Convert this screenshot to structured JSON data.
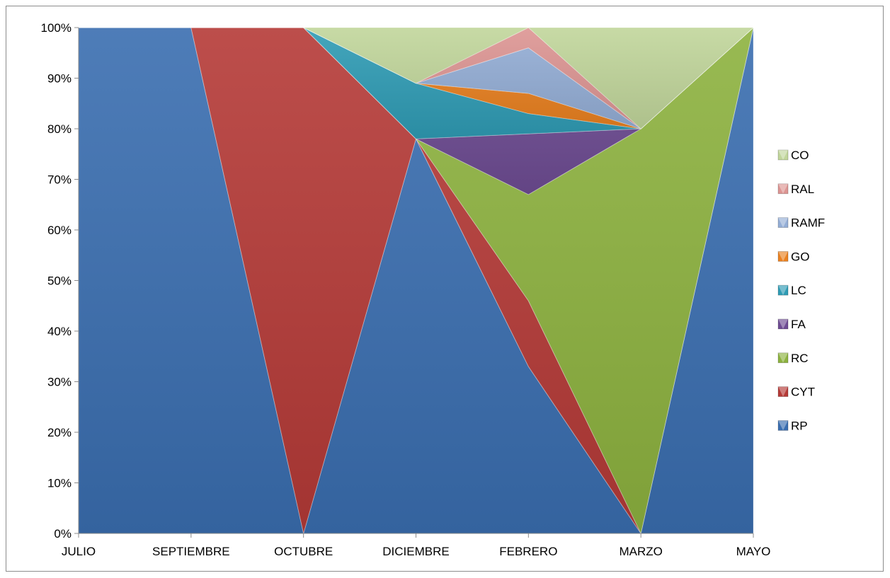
{
  "chart_data": {
    "type": "area",
    "stacked": true,
    "percent": true,
    "categories": [
      "JULIO",
      "SEPTIEMBRE",
      "OCTUBRE",
      "DICIEMBRE",
      "FEBRERO",
      "MARZO",
      "MAYO"
    ],
    "series": [
      {
        "name": "RP",
        "color": "#3a6eb0",
        "values": [
          100,
          100,
          0,
          78,
          33,
          0,
          100
        ]
      },
      {
        "name": "CYT",
        "color": "#b53a37",
        "values": [
          0,
          0,
          100,
          0,
          13,
          0,
          0
        ]
      },
      {
        "name": "RC",
        "color": "#8db23f",
        "values": [
          0,
          0,
          0,
          0,
          21,
          80,
          0
        ]
      },
      {
        "name": "FA",
        "color": "#6e4c93",
        "values": [
          0,
          0,
          0,
          0,
          12,
          0,
          0
        ]
      },
      {
        "name": "LC",
        "color": "#2f9cb5",
        "values": [
          0,
          0,
          0,
          11,
          4,
          0,
          0
        ]
      },
      {
        "name": "GO",
        "color": "#ea8120",
        "values": [
          0,
          0,
          0,
          0,
          4,
          0,
          0
        ]
      },
      {
        "name": "RAMF",
        "color": "#94aed6",
        "values": [
          0,
          0,
          0,
          0,
          9,
          0,
          0
        ]
      },
      {
        "name": "RAL",
        "color": "#dd9593",
        "values": [
          0,
          0,
          0,
          0,
          4,
          0,
          0
        ]
      },
      {
        "name": "CO",
        "color": "#c1d69b",
        "values": [
          0,
          0,
          0,
          11,
          0,
          20,
          0
        ]
      }
    ],
    "yticks": [
      "0%",
      "10%",
      "20%",
      "30%",
      "40%",
      "50%",
      "60%",
      "70%",
      "80%",
      "90%",
      "100%"
    ],
    "ylim": [
      0,
      100
    ],
    "legend_position": "right",
    "grid": false
  }
}
